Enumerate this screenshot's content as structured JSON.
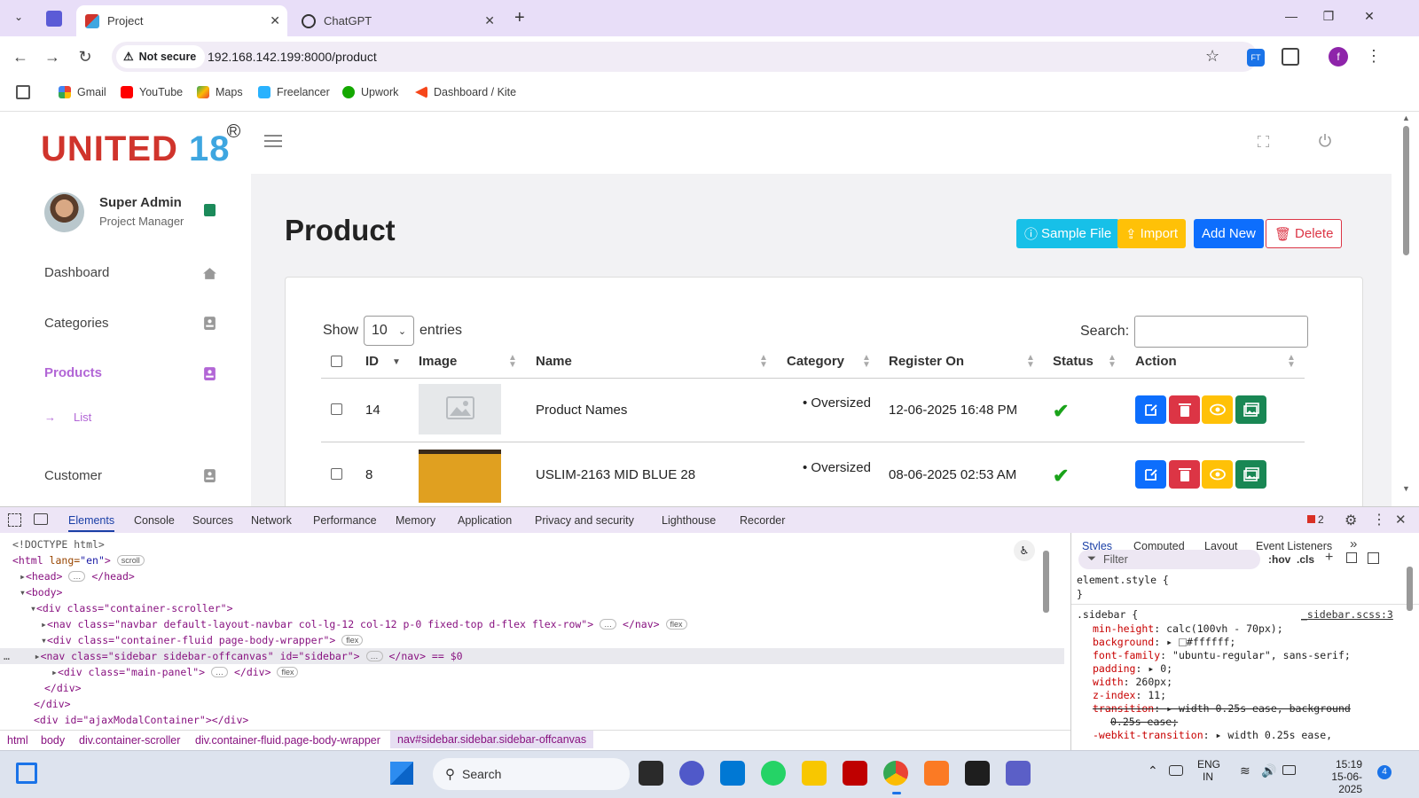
{
  "browser": {
    "tabs": [
      {
        "label": "Project",
        "active": true
      },
      {
        "label": "ChatGPT",
        "active": false
      }
    ],
    "security_label": "Not secure",
    "url": "192.168.142.199:8000/product",
    "profile_initial": "f",
    "ext_label": "FT",
    "bookmarks": [
      "Gmail",
      "YouTube",
      "Maps",
      "Freelancer",
      "Upwork",
      "Dashboard / Kite"
    ]
  },
  "app": {
    "logo_part1": "UNITED",
    "logo_part2": "18",
    "logo_mark": "R",
    "user": {
      "name": "Super Admin",
      "role": "Project Manager"
    },
    "nav": [
      {
        "label": "Dashboard",
        "icon": "home-icon"
      },
      {
        "label": "Categories",
        "icon": "contact-card-icon"
      },
      {
        "label": "Products",
        "icon": "contact-card-icon",
        "active": true
      },
      {
        "label": "Customer",
        "icon": "contact-card-icon"
      }
    ],
    "subnav": {
      "label": "List"
    },
    "page_title": "Product",
    "buttons": {
      "sample": "Sample File",
      "import": "Import",
      "add": "Add New",
      "delete": "Delete"
    },
    "colors": {
      "sample": "#17c0e8",
      "import": "#ffc107",
      "add": "#0d6efd",
      "delete": "#dc3545",
      "accent": "#b266d6",
      "edit": "#0d6efd",
      "trash": "#dc3545",
      "view": "#ffc107",
      "gallery": "#198754"
    },
    "table": {
      "show_label": "Show",
      "entries_label": "entries",
      "page_size": "10",
      "search_label": "Search:",
      "headers": [
        "ID",
        "Image",
        "Name",
        "Category",
        "Register On",
        "Status",
        "Action"
      ],
      "rows": [
        {
          "id": "14",
          "name": "Product Names",
          "category": "Oversized",
          "registered": "12-06-2025 16:48 PM",
          "status": "active"
        },
        {
          "id": "8",
          "name": "USLIM-2163 MID BLUE 28",
          "category": "Oversized",
          "registered": "08-06-2025 02:53 AM",
          "status": "active"
        }
      ]
    }
  },
  "devtools": {
    "tabs": [
      "Elements",
      "Console",
      "Sources",
      "Network",
      "Performance",
      "Memory",
      "Application",
      "Privacy and security",
      "Lighthouse",
      "Recorder"
    ],
    "issues_count": "2",
    "dom_lines": {
      "l1": "<!DOCTYPE html>",
      "l2_tag": "<html",
      "l2_attr": " lang=",
      "l2_val": "\"en\"",
      "l2_end": ">",
      "l2_pill": "scroll",
      "l3": "<head>",
      "l3_end": "</head>",
      "l4": "<body>",
      "l5": "<div class=\"container-scroller\">",
      "l6": "<nav class=\"navbar default-layout-navbar col-lg-12 col-12 p-0 fixed-top d-flex flex-row\">",
      "l6_end": "</nav>",
      "l7": "<div class=\"container-fluid page-body-wrapper\">",
      "l8": "<nav class=\"sidebar sidebar-offcanvas\" id=\"sidebar\">",
      "l8_end": "</nav> == $0",
      "l9": "<div class=\"main-panel\">",
      "l9_end": "</div>",
      "l10": "</div>",
      "l11": "</div>",
      "l12": "<div id=\"ajaxModalContainer\"></div>",
      "pill_flex": "flex"
    },
    "breadcrumb": [
      "html",
      "body",
      "div.container-scroller",
      "div.container-fluid.page-body-wrapper",
      "nav#sidebar.sidebar.sidebar-offcanvas"
    ],
    "styles_tabs": [
      "Styles",
      "Computed",
      "Layout",
      "Event Listeners"
    ],
    "filter_placeholder": "Filter",
    "hov": ":hov",
    "cls": ".cls",
    "rules": {
      "elem": "element.style {",
      "elem_close": "}",
      "selector": ".sidebar {",
      "source": "_sidebar.scss:3",
      "props": [
        {
          "name": "min-height",
          "value": "calc(100vh - 70px);"
        },
        {
          "name": "background",
          "value": "#ffffff;"
        },
        {
          "name": "font-family",
          "value": "\"ubuntu-regular\", sans-serif;"
        },
        {
          "name": "padding",
          "value": "0;"
        },
        {
          "name": "width",
          "value": "260px;"
        },
        {
          "name": "z-index",
          "value": "11;"
        },
        {
          "name": "transition",
          "value": "width 0.25s ease, background"
        },
        {
          "name": "",
          "value": "0.25s ease;"
        },
        {
          "name": "-webkit-transition",
          "value": "width 0.25s ease,"
        }
      ]
    }
  },
  "taskbar": {
    "search_placeholder": "Search",
    "lang1": "ENG",
    "lang2": "IN",
    "time": "15:19",
    "date": "15-06-2025",
    "notif": "4"
  }
}
